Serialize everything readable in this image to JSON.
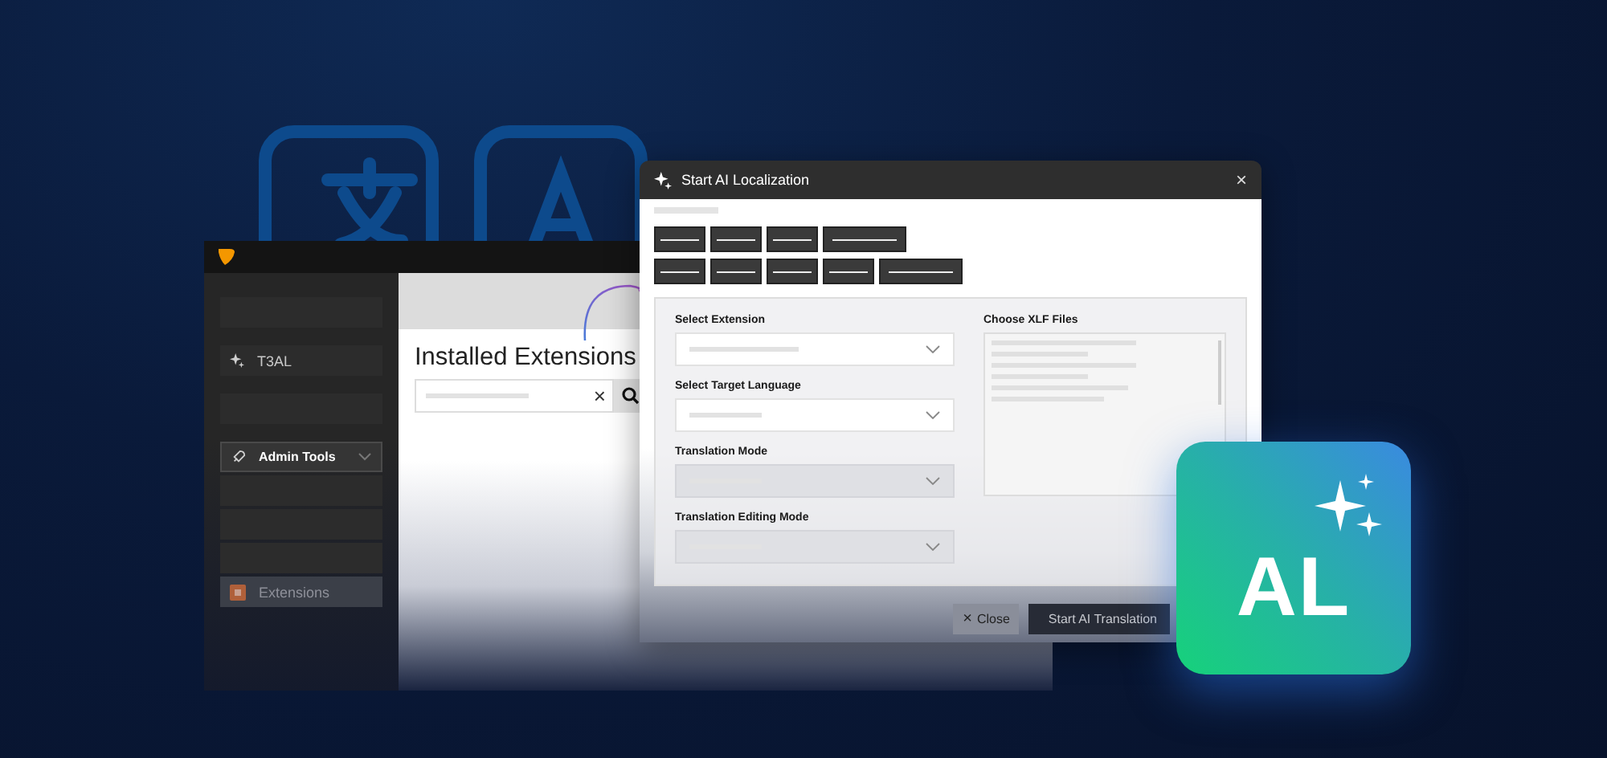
{
  "backend": {
    "sidebar": {
      "items": [
        {
          "kind": "blank",
          "selected": false
        },
        {
          "kind": "module",
          "label": "T3AL",
          "selected": false
        },
        {
          "kind": "blank",
          "selected": false
        },
        {
          "kind": "group",
          "label": "Admin Tools",
          "selected": true,
          "children": [
            {
              "kind": "blank",
              "selected": false
            },
            {
              "kind": "blank",
              "selected": false
            },
            {
              "kind": "blank",
              "selected": false
            },
            {
              "kind": "module",
              "label": "Extensions",
              "selected": true
            }
          ]
        }
      ]
    },
    "content": {
      "title": "Installed Extensions",
      "search": {
        "clear": "×"
      }
    }
  },
  "dialog": {
    "title": "Start AI Localization",
    "close": "×",
    "button_rows": [
      [
        {
          "kind": "short"
        },
        {
          "kind": "short"
        },
        {
          "kind": "short"
        },
        {
          "kind": "long"
        }
      ],
      [
        {
          "kind": "short"
        },
        {
          "kind": "short"
        },
        {
          "kind": "short"
        },
        {
          "kind": "short"
        },
        {
          "kind": "long"
        }
      ]
    ],
    "fields": [
      {
        "label": "Select Extension",
        "disabled": false
      },
      {
        "label": "Select Target Language",
        "disabled": false
      },
      {
        "label": "Translation Mode",
        "disabled": true
      },
      {
        "label": "Translation Editing Mode",
        "disabled": true
      }
    ],
    "files": {
      "label": "Choose XLF Files"
    },
    "buttons": [
      {
        "kind": "secondary",
        "label": "Close",
        "icon": "×"
      },
      {
        "kind": "primary",
        "label": "Start AI Translation"
      }
    ]
  },
  "badge": {
    "label": "AL"
  }
}
